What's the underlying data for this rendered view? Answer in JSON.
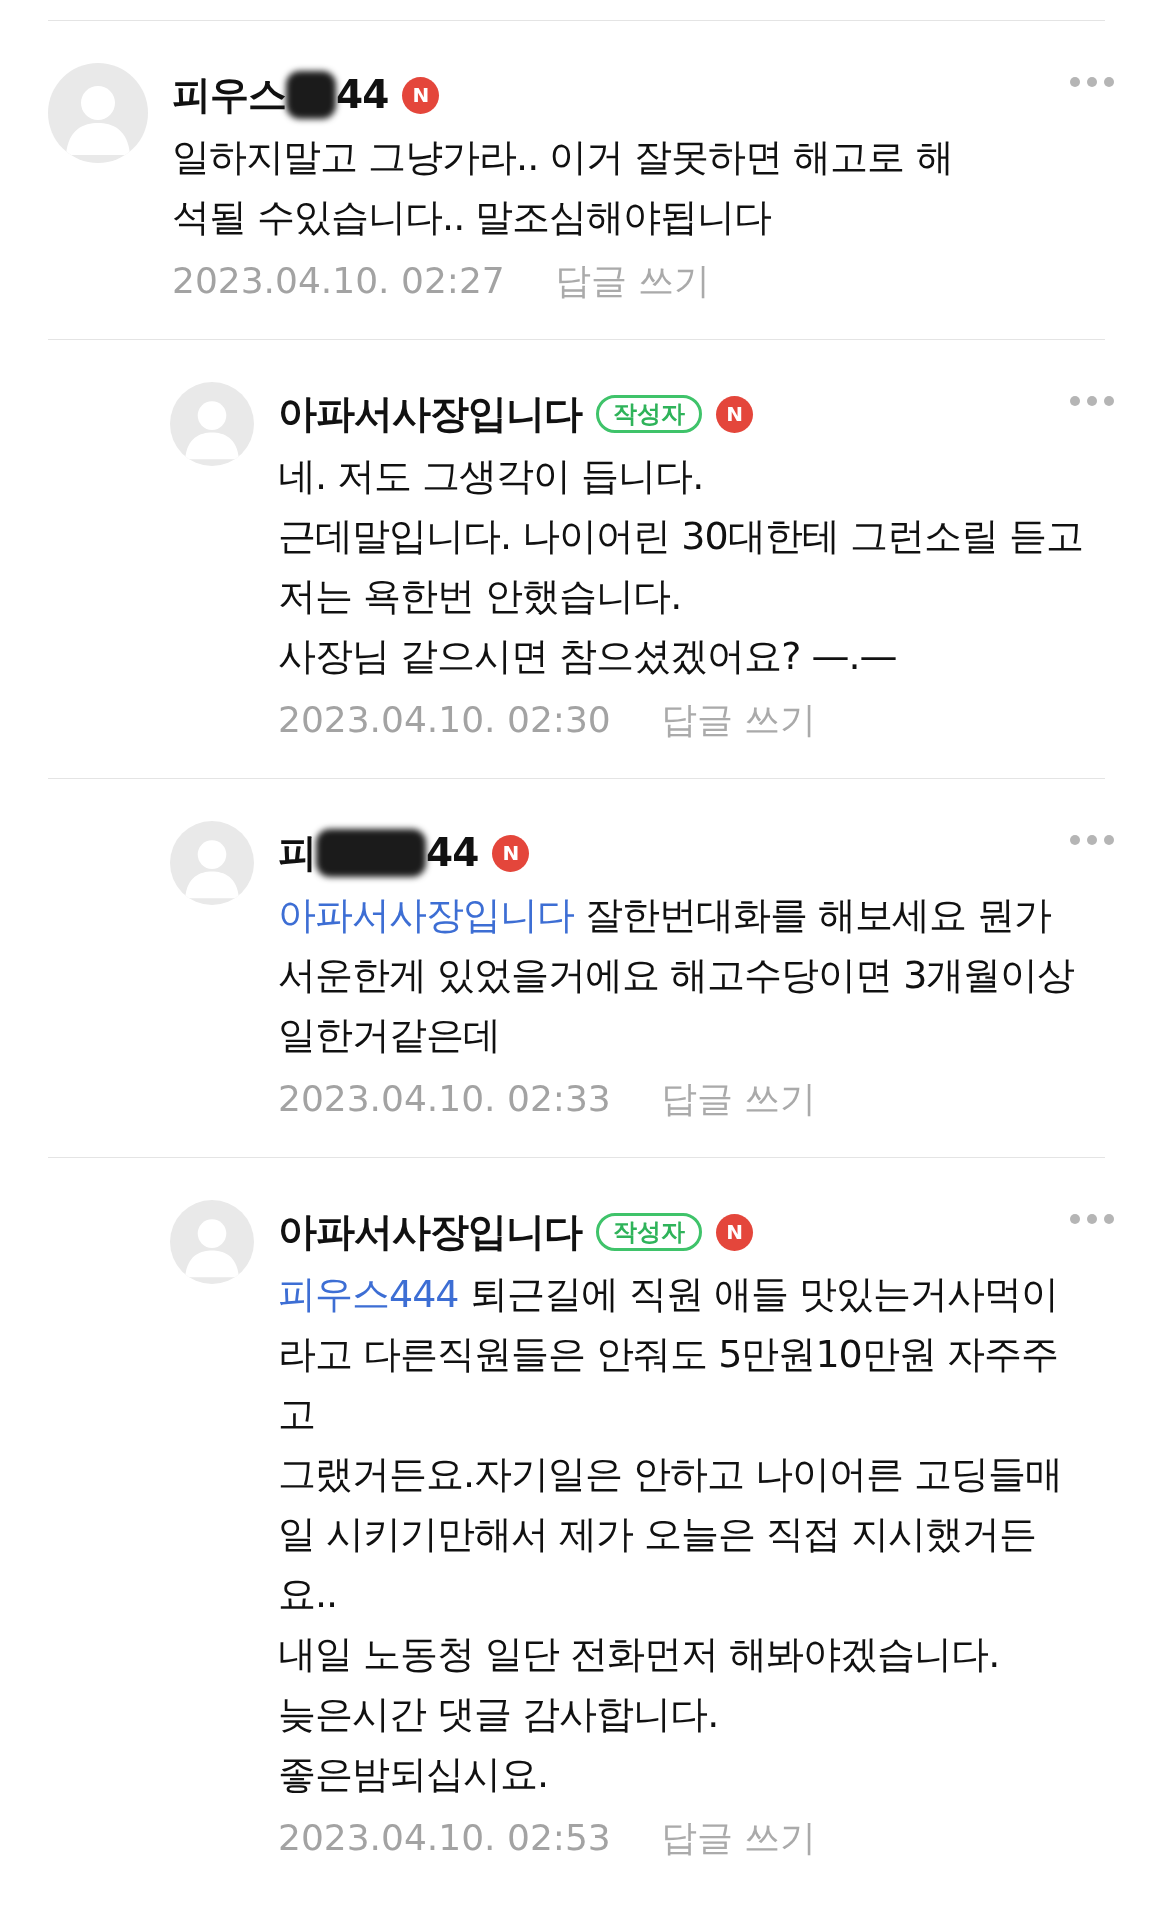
{
  "comments": [
    {
      "kind": "comment",
      "author_start": "피우스",
      "redacted": true,
      "author_end": "44",
      "new_badge": "N",
      "paragraphs": [
        "일하지말고 그냥가라.. 이거 잘못하면 해고로 해석될 수있습니다.. 말조심해야됩니다"
      ],
      "date": "2023.04.10. 02:27",
      "reply_link": "답글 쓰기"
    },
    {
      "kind": "reply",
      "author_start": "아파서사장입니다",
      "redacted": false,
      "writer_badge": "작성자",
      "new_badge": "N",
      "paragraphs": [
        "네. 저도 그생각이 듭니다.",
        "근데말입니다. 나이어린 30대한테 그런소릴 듣고 저는 욕한번 안했습니다.",
        "사장님 같으시면 참으셨겠어요? —.—"
      ],
      "date": "2023.04.10. 02:30",
      "reply_link": "답글 쓰기"
    },
    {
      "kind": "reply",
      "author_start": "피",
      "redacted": true,
      "author_end": "44",
      "new_badge": "N",
      "mention": "아파서사장입니다",
      "paragraphs": [
        "잘한번대화를 해보세요 뭔가 서운한게 있었을거에요 해고수당이면 3개월이상일한거같은데"
      ],
      "date": "2023.04.10. 02:33",
      "reply_link": "답글 쓰기"
    },
    {
      "kind": "reply",
      "author_start": "아파서사장입니다",
      "redacted": false,
      "writer_badge": "작성자",
      "new_badge": "N",
      "mention": "피우스444",
      "paragraphs": [
        "퇴근길에 직원 애들 맛있는거사먹이라고 다른직원들은 안줘도 5만원10만원 자주주고",
        "그랬거든요.자기일은 안하고 나이어른 고딩들매일 시키기만해서 제가 오늘은 직접 지시했거든요..",
        "내일 노동청 일단 전화먼저 해봐야겠습니다.",
        "늦은시간 댓글 감사합니다.",
        "좋은밤되십시요."
      ],
      "date": "2023.04.10. 02:53",
      "reply_link": "답글 쓰기"
    }
  ]
}
